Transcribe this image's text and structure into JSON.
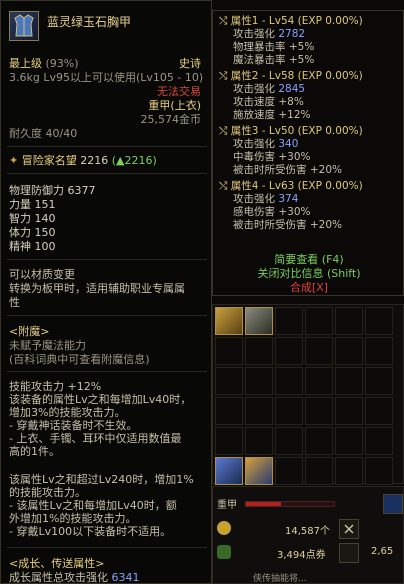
{
  "tooltip": {
    "item_name": "蓝灵绿玉石胸甲",
    "grade": "最上级",
    "grade_pct": "(93%)",
    "rarity": "史诗",
    "weight": "3.6kg",
    "level_req": "Lv95以上可以使用(Lv105 - 10)",
    "no_trade": "无法交易",
    "armor_type": "重甲(上衣)",
    "price": "25,574金币",
    "durability": "耐久度 40/40",
    "fame_label": "冒险家名望",
    "fame_value": "2216",
    "fame_delta": "(▲2216)",
    "stats": [
      {
        "label": "物理防御力",
        "value": "6377"
      },
      {
        "label": "力量",
        "value": "151"
      },
      {
        "label": "智力",
        "value": "140"
      },
      {
        "label": "体力",
        "value": "150"
      },
      {
        "label": "精神",
        "value": "100"
      }
    ],
    "material_change": "可以材质变更",
    "convert_1": "转换为板甲时，适用辅助职业专属属",
    "convert_2": "性",
    "enchant_title": "<附魔>",
    "enchant_1": "未赋予魔法能力",
    "enchant_2": "(百科词典中可查看附魔信息)",
    "skill_lines": [
      "技能攻击力 +12%",
      "该装备的属性Lv之和每增加Lv40时，",
      "增加3%的技能攻击力。",
      "- 穿戴神话装备时不生效。",
      "- 上衣、手镯、耳环中仅适用数值最",
      "高的1件。"
    ],
    "extra_lines": [
      "该属性Lv之和超过Lv240时，增加1%",
      "的技能攻击力。",
      "- 该属性Lv之和每增加Lv40时，额",
      "外增加1%的技能攻击力。",
      "- 穿戴Lv100以下装备时不适用。"
    ],
    "growth_title": "<成长、传送属性>",
    "growth_line_label": "成长属性总攻击强化",
    "growth_line_value": "6341"
  },
  "props": {
    "groups": [
      {
        "title": "属性1 - Lv54 (EXP 0.00%)",
        "atk_label": "攻击强化",
        "atk": "2782",
        "lines": [
          "物理暴击率 +5%",
          "魔法暴击率 +5%"
        ]
      },
      {
        "title": "属性2 - Lv58 (EXP 0.00%)",
        "atk_label": "攻击强化",
        "atk": "2845",
        "lines": [
          "攻击速度 +8%",
          "施放速度 +12%"
        ]
      },
      {
        "title": "属性3 - Lv50 (EXP 0.00%)",
        "atk_label": "攻击强化",
        "atk": "340",
        "lines": [
          "中毒伤害 +30%",
          "被击时所受伤害 +20%"
        ]
      },
      {
        "title": "属性4 - Lv63 (EXP 0.00%)",
        "atk_label": "攻击强化",
        "atk": "374",
        "lines": [
          "感电伤害 +30%",
          "被击时所受伤害 +20%"
        ]
      }
    ],
    "hint_brief": "简要查看 (F4)",
    "hint_compare": "关闭对比信息 (Shift)",
    "hint_synth": "合成[X]"
  },
  "bottom": {
    "armor_label": "重甲",
    "gold": "14,587个",
    "points": "3,494点券",
    "points2": "2,65",
    "ticker": "侠传抽能将..."
  },
  "colors": {
    "gold": "#e8d080",
    "blue": "#8aa0ff",
    "red": "#d84a3a"
  }
}
